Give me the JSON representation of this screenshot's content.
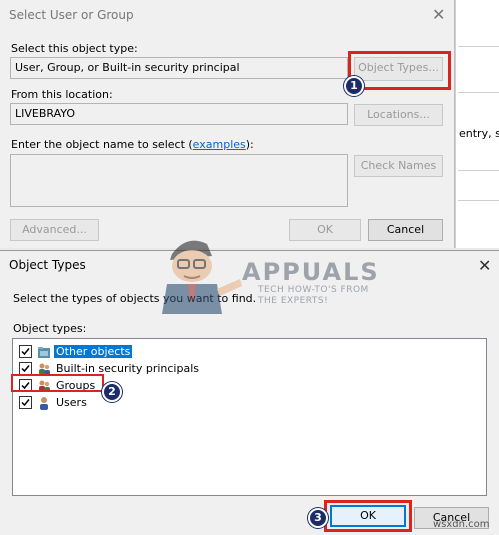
{
  "select_dialog": {
    "title": "Select User or Group",
    "object_type_label": "Select this object type:",
    "object_type_value": "User, Group, or Built-in security principal",
    "object_types_button": "Object Types...",
    "location_label": "From this location:",
    "location_value": "LIVEBRAYO",
    "locations_button": "Locations...",
    "enter_name_label_prefix": "Enter the object name to select (",
    "enter_name_link": "examples",
    "enter_name_label_suffix": "):",
    "check_names_button": "Check Names",
    "advanced_button": "Advanced...",
    "ok_button": "OK",
    "cancel_button": "Cancel"
  },
  "background_window": {
    "partial_text": "entry, se"
  },
  "object_types_dialog": {
    "title": "Object Types",
    "instruction": "Select the types of objects you want to find.",
    "list_label": "Object types:",
    "items": [
      {
        "label": "Other objects",
        "checked": true,
        "selected": true
      },
      {
        "label": "Built-in security principals",
        "checked": true,
        "selected": false
      },
      {
        "label": "Groups",
        "checked": true,
        "selected": false
      },
      {
        "label": "Users",
        "checked": true,
        "selected": false
      }
    ],
    "ok_button": "OK",
    "cancel_button": "Cancel"
  },
  "annotations": {
    "step1": "1",
    "step2": "2",
    "step3": "3"
  },
  "watermark": {
    "brand": "APPUALS",
    "tagline_line1": "TECH HOW-TO'S FROM",
    "tagline_line2": "THE EXPERTS!"
  },
  "site_label": "wsxdn.com",
  "colors": {
    "annotation_red": "#d9241f",
    "badge_navy": "#1c2b6a",
    "selection_blue": "#0078d7",
    "link_blue": "#0066cc"
  },
  "icons": {
    "close": "close-icon",
    "other_objects": "folder-icon",
    "builtin": "group-icon",
    "groups": "group-icon",
    "users": "user-icon"
  }
}
